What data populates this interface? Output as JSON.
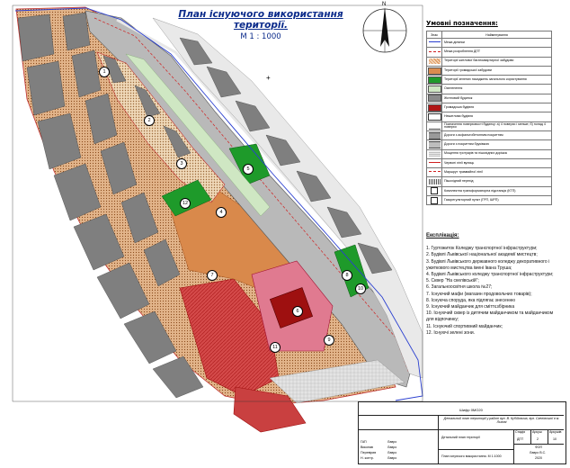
{
  "title": {
    "line1": "План існуючого використання території.",
    "line2": "М 1 : 1000"
  },
  "compass": {
    "north_label": "N"
  },
  "legend": {
    "heading": "Умовні позначення:",
    "col_symbol": "Знак",
    "col_name": "Найменування",
    "items": [
      {
        "label": "Межа ділянки",
        "color": "#2a3fd0",
        "kind": "line"
      },
      {
        "label": "Межа розроблення ДПТ",
        "color": "#d02020",
        "kind": "dash"
      },
      {
        "label": "Території житлової багатоквартирної забудови",
        "color": "#d98b4f",
        "kind": "hatch"
      },
      {
        "label": "Території громадської забудови",
        "color": "#d98b4f",
        "kind": "fill"
      },
      {
        "label": "Території зелених насаджень загального користування",
        "color": "#1e9a2a",
        "kind": "fill"
      },
      {
        "label": "Озеленення",
        "color": "#cfe7c3",
        "kind": "fill"
      },
      {
        "label": "Житловий будинок",
        "color": "#8a8a8a",
        "kind": "fill"
      },
      {
        "label": "Громадська будівля",
        "color": "#b01515",
        "kind": "fill"
      },
      {
        "label": "Нежитлова будівля",
        "color": "#ffffff",
        "kind": "box"
      },
      {
        "label": "Позначення поверховості будинку: а) 4 поверхи і менше; б) понад 4 поверхи",
        "color": "#444444",
        "kind": "text"
      },
      {
        "label": "Дороги з асфальтобетонним покриттям",
        "color": "#9a9a9a",
        "kind": "road"
      },
      {
        "label": "Дороги з покриттям бруківкою",
        "color": "#bdbdbd",
        "kind": "road"
      },
      {
        "label": "Мощення тротуарів та пішохідних доріжок",
        "color": "#cccccc",
        "kind": "hatch2"
      },
      {
        "label": "Червоні лінії вулиць",
        "color": "#d02020",
        "kind": "line"
      },
      {
        "label": "Маршрут трамвайної лінії",
        "color": "#d02020",
        "kind": "dashline"
      },
      {
        "label": "Пішохідний перехід",
        "color": "#555555",
        "kind": "zebra"
      },
      {
        "label": "Комплектна трансформаторна підстанція (КТП)",
        "color": "#222222",
        "kind": "icon"
      },
      {
        "label": "Газорегуляторний пункт (ГРП, ШРП)",
        "color": "#222222",
        "kind": "icon"
      }
    ]
  },
  "explication": {
    "heading": "Експлікація:",
    "items": [
      "1. Гуртожиток Коледжу транспортної інфраструктури;",
      "2. Будівлі Львівської національної академії мистецтв;",
      "3. Будівлі Львівського державного коледжу декоративного і ужиткового мистецтва імені Івана Труша;",
      "4. Будівлі Львівського коледжу транспортної інфраструктури;",
      "5. Сквер \"На скелівській\";",
      "6. Загальноосвітня школа №27;",
      "7. Існуючий мафи (магазин продовольчих товарів);",
      "8. Існуюча споруда, яка підлягає знесенню",
      "9. Існуючий майданчик для сміттєзбірника",
      "10. Існуючий сквер із дитячим майданчиком та майданчиком для відпочинку;",
      "11. Існуючий спортивний майданчик;",
      "12. Існуючі зелені зони."
    ]
  },
  "stamp": {
    "code": "Шифр 0МО20",
    "project": "Детальний план території у районі вул. В. Кубійовича, вул. Скелівської в м. Львові",
    "stage_h": "Стадія",
    "sheet_h": "Аркуш",
    "sheets_h": "Аркушів",
    "stage": "ДПТ",
    "sheet": "2",
    "sheets": "10",
    "drawing1": "Детальний план території",
    "drawing2": "План існуючого використання. М 1:1000",
    "org1": "ФОП",
    "org2": "Лавро В.С.",
    "year": "2020",
    "roles": [
      "ГАП",
      "Виконав",
      "Перевірив",
      "Н. контр."
    ],
    "names": [
      "Лавро",
      "Лавро",
      "Лавро",
      "Лавро"
    ]
  },
  "markers": [
    "1",
    "2",
    "3",
    "4",
    "5",
    "6",
    "7",
    "8",
    "9",
    "10",
    "11",
    "12"
  ]
}
